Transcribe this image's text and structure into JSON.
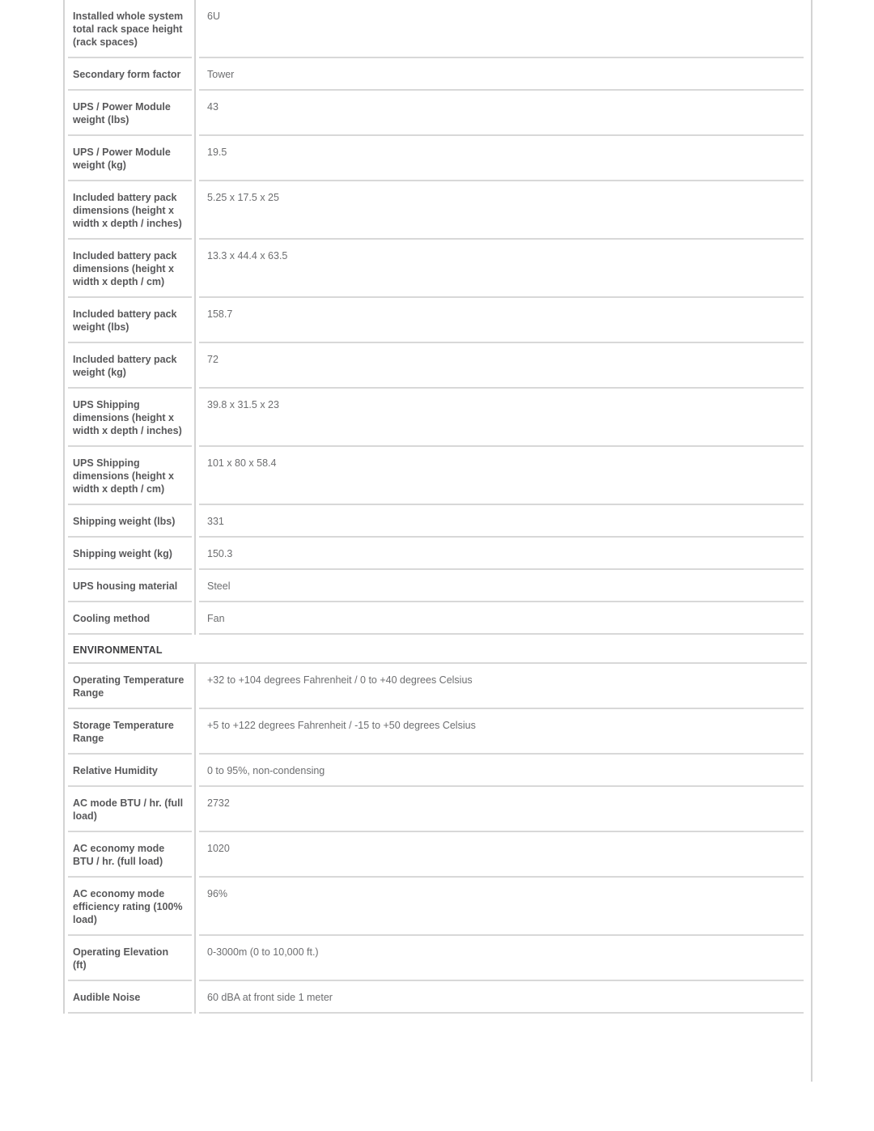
{
  "table": {
    "rows": [
      {
        "type": "spec",
        "label": "Installed whole system total rack space height (rack spaces)",
        "value": "6U"
      },
      {
        "type": "spec",
        "label": "Secondary form factor",
        "value": "Tower"
      },
      {
        "type": "spec",
        "label": "UPS / Power Module weight (lbs)",
        "value": "43"
      },
      {
        "type": "spec",
        "label": "UPS / Power Module weight (kg)",
        "value": "19.5"
      },
      {
        "type": "spec",
        "label": "Included battery pack dimensions (height x width x depth / inches)",
        "value": "5.25 x 17.5 x 25"
      },
      {
        "type": "spec",
        "label": "Included battery pack dimensions (height x width x depth / cm)",
        "value": "13.3 x 44.4 x 63.5"
      },
      {
        "type": "spec",
        "label": "Included battery pack weight (lbs)",
        "value": "158.7"
      },
      {
        "type": "spec",
        "label": "Included battery pack weight (kg)",
        "value": "72"
      },
      {
        "type": "spec",
        "label": "UPS Shipping dimensions (height x width x depth / inches)",
        "value": "39.8 x 31.5 x 23"
      },
      {
        "type": "spec",
        "label": "UPS Shipping dimensions (height x width x depth / cm)",
        "value": "101 x 80 x 58.4"
      },
      {
        "type": "spec",
        "label": "Shipping weight (lbs)",
        "value": "331"
      },
      {
        "type": "spec",
        "label": "Shipping weight (kg)",
        "value": "150.3"
      },
      {
        "type": "spec",
        "label": "UPS housing material",
        "value": "Steel"
      },
      {
        "type": "spec",
        "label": "Cooling method",
        "value": "Fan"
      },
      {
        "type": "section",
        "label": "ENVIRONMENTAL"
      },
      {
        "type": "spec",
        "label": "Operating Temperature Range",
        "value": "+32 to +104 degrees Fahrenheit / 0 to +40 degrees Celsius"
      },
      {
        "type": "spec",
        "label": "Storage Temperature Range",
        "value": "+5 to +122 degrees Fahrenheit / -15 to +50 degrees Celsius"
      },
      {
        "type": "spec",
        "label": "Relative Humidity",
        "value": "0 to 95%, non-condensing"
      },
      {
        "type": "spec",
        "label": "AC mode BTU / hr. (full load)",
        "value": "2732"
      },
      {
        "type": "spec",
        "label": "AC economy mode BTU / hr. (full load)",
        "value": "1020"
      },
      {
        "type": "spec",
        "label": "AC economy mode efficiency rating (100% load)",
        "value": "96%"
      },
      {
        "type": "spec",
        "label": "Operating Elevation (ft)",
        "value": "0-3000m (0 to 10,000 ft.)"
      },
      {
        "type": "spec",
        "label": "Audible Noise",
        "value": "60 dBA at front side 1 meter"
      }
    ]
  },
  "colors": {
    "label_text": "#58585a",
    "value_text": "#6d6e70",
    "section_text": "#3f3f41",
    "rule": "#d3d3d3",
    "row_separator": "#d8d8d8",
    "background": "#ffffff"
  }
}
